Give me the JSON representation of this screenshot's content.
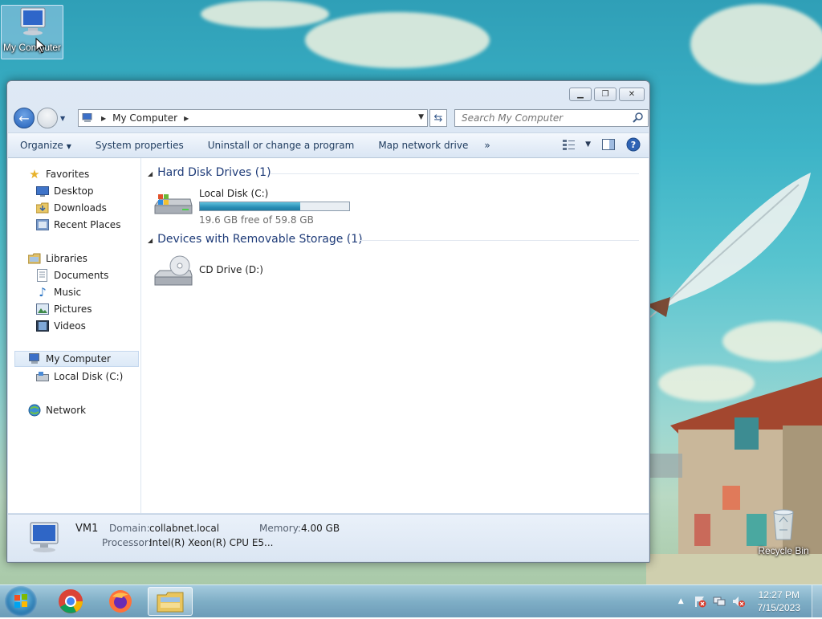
{
  "desktop": {
    "icons": [
      {
        "label": "My Computer"
      },
      {
        "label": "Recycle Bin"
      }
    ]
  },
  "window": {
    "address": {
      "crumbs": [
        "My Computer"
      ]
    },
    "search": {
      "placeholder": "Search My Computer"
    },
    "toolbar": {
      "organize": "Organize",
      "system_properties": "System properties",
      "uninstall": "Uninstall or change a program",
      "map_drive": "Map network drive",
      "more": "»"
    },
    "nav": {
      "favorites": "Favorites",
      "desktop": "Desktop",
      "downloads": "Downloads",
      "recent": "Recent Places",
      "libraries": "Libraries",
      "documents": "Documents",
      "music": "Music",
      "pictures": "Pictures",
      "videos": "Videos",
      "computer": "My Computer",
      "local_disk": "Local Disk (C:)",
      "network": "Network"
    },
    "groups": {
      "hdd": "Hard Disk Drives (1)",
      "removable": "Devices with Removable Storage (1)"
    },
    "drives": {
      "c": {
        "name": "Local Disk (C:)",
        "free_text": "19.6 GB free of 59.8 GB",
        "used_fraction": 0.672
      },
      "d": {
        "name": "CD Drive (D:)"
      }
    },
    "details": {
      "computer_name": "VM1",
      "domain_label": "Domain:",
      "domain_value": "collabnet.local",
      "memory_label": "Memory:",
      "memory_value": "4.00 GB",
      "processor_label": "Processor:",
      "processor_value": "Intel(R) Xeon(R) CPU E5..."
    }
  },
  "taskbar": {
    "apps": [
      "start-orb",
      "chrome",
      "firefox",
      "windows-explorer"
    ],
    "clock": {
      "time": "12:27 PM",
      "date": "7/15/2023"
    }
  },
  "colors": {
    "accent": "#2460b8",
    "group_header": "#1e3b78",
    "drive_fill": "#2a8fb6"
  }
}
